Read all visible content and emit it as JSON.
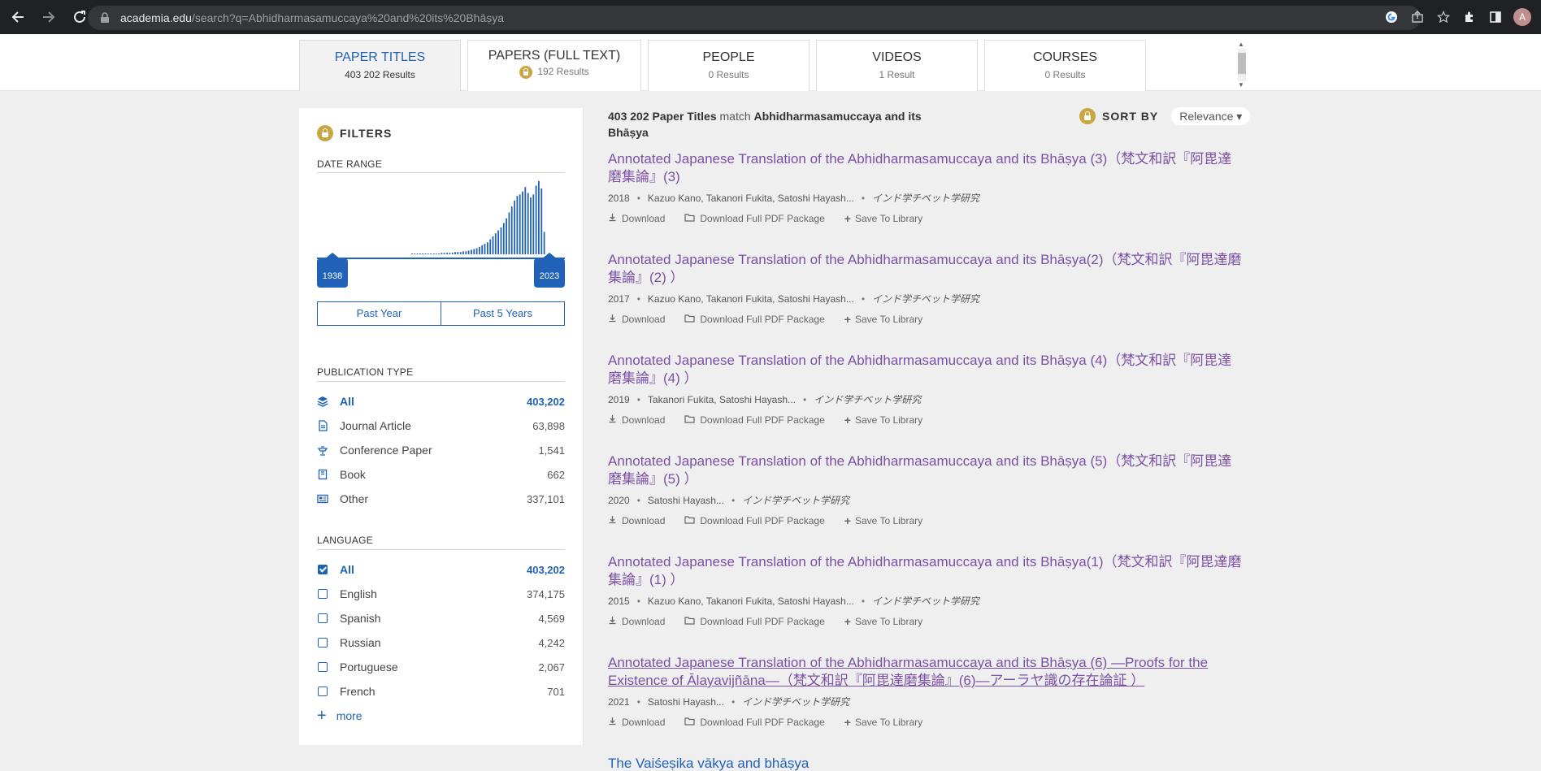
{
  "browser": {
    "url_domain": "academia.edu",
    "url_path": "/search?q=Abhidharmasamuccaya%20and%20its%20Bhāṣya",
    "avatar_letter": "A"
  },
  "tabs": [
    {
      "label": "PAPER TITLES",
      "count": "403 202 Results"
    },
    {
      "label": "PAPERS (FULL TEXT)",
      "count": "192 Results"
    },
    {
      "label": "PEOPLE",
      "count": "0 Results"
    },
    {
      "label": "VIDEOS",
      "count": "1 Result"
    },
    {
      "label": "COURSES",
      "count": "0 Results"
    }
  ],
  "filters": {
    "title": "FILTERS",
    "date_range_label": "DATE RANGE",
    "year_start": "1938",
    "year_end": "2023",
    "histogram_levels": [
      0.01,
      0.01,
      0.01,
      0.01,
      0.01,
      0.01,
      0.01,
      0.01,
      0.01,
      0.01,
      0.01,
      0.02,
      0.02,
      0.02,
      0.02,
      0.02,
      0.03,
      0.03,
      0.03,
      0.04,
      0.04,
      0.05,
      0.06,
      0.07,
      0.08,
      0.1,
      0.12,
      0.14,
      0.16,
      0.2,
      0.24,
      0.28,
      0.32,
      0.36,
      0.42,
      0.48,
      0.56,
      0.64,
      0.72,
      0.78,
      0.8,
      0.84,
      0.9,
      0.82,
      0.76,
      0.8,
      0.92,
      0.98,
      0.88,
      0.3
    ],
    "past_year": "Past Year",
    "past_5_years": "Past 5 Years",
    "publication_type_label": "PUBLICATION TYPE",
    "publication_types": [
      {
        "label": "All",
        "count": "403,202",
        "selected": true,
        "icon": "layers-icon"
      },
      {
        "label": "Journal Article",
        "count": "63,898",
        "selected": false,
        "icon": "document-icon"
      },
      {
        "label": "Conference Paper",
        "count": "1,541",
        "selected": false,
        "icon": "lectern-icon"
      },
      {
        "label": "Book",
        "count": "662",
        "selected": false,
        "icon": "book-icon"
      },
      {
        "label": "Other",
        "count": "337,101",
        "selected": false,
        "icon": "newspaper-icon"
      }
    ],
    "language_label": "LANGUAGE",
    "languages": [
      {
        "label": "All",
        "count": "403,202",
        "selected": true
      },
      {
        "label": "English",
        "count": "374,175",
        "selected": false
      },
      {
        "label": "Spanish",
        "count": "4,569",
        "selected": false
      },
      {
        "label": "Russian",
        "count": "4,242",
        "selected": false
      },
      {
        "label": "Portuguese",
        "count": "2,067",
        "selected": false
      },
      {
        "label": "French",
        "count": "701",
        "selected": false
      }
    ],
    "more": "more"
  },
  "results_summary": {
    "count": "403 202 Paper Titles",
    "match_word": " match ",
    "query": "Abhidharmasamuccaya and its Bhāṣya"
  },
  "sort": {
    "label": "SORT BY",
    "value": "Relevance ▾"
  },
  "actions": {
    "download": "Download",
    "pdf_package": "Download Full PDF Package",
    "save": "Save To Library"
  },
  "results": [
    {
      "title": "Annotated Japanese Translation of the Abhidharmasamuccaya and its Bhāṣya (3)（梵文和訳『阿毘達磨集論』(3)",
      "year": "2018",
      "authors": "Kazuo Kano, Takanori Fukita, Satoshi Hayash...",
      "journal": "インド学チベット学研究"
    },
    {
      "title": "Annotated Japanese Translation of the Abhidharmasamuccaya and its Bhāṣya(2)（梵文和訳『阿毘達磨集論』(2) ）",
      "year": "2017",
      "authors": "Kazuo Kano, Takanori Fukita, Satoshi Hayash...",
      "journal": "インド学チベット学研究"
    },
    {
      "title": "Annotated Japanese Translation of the Abhidharmasamuccaya and its Bhāṣya (4)（梵文和訳『阿毘達磨集論』(4) ）",
      "year": "2019",
      "authors": "Takanori Fukita, Satoshi Hayash...",
      "journal": "インド学チベット学研究"
    },
    {
      "title": "Annotated Japanese Translation of the Abhidharmasamuccaya and its Bhāṣya (5)（梵文和訳『阿毘達磨集論』(5) ）",
      "year": "2020",
      "authors": "Satoshi Hayash...",
      "journal": "インド学チベット学研究"
    },
    {
      "title": "Annotated Japanese Translation of the Abhidharmasamuccaya and its Bhāṣya(1)（梵文和訳『阿毘達磨集論』(1) ）",
      "year": "2015",
      "authors": "Kazuo Kano, Takanori Fukita, Satoshi Hayash...",
      "journal": "インド学チベット学研究"
    },
    {
      "title": "Annotated Japanese Translation of the Abhidharmasamuccaya and its Bhāṣya (6) ―Proofs for the Existence of Ālayavijñāna―（梵文和訳『阿毘達磨集論』(6)―アーラヤ識の存在論証 ）",
      "year": "2021",
      "authors": "Satoshi Hayash...",
      "journal": "インド学チベット学研究"
    }
  ],
  "partial_result": {
    "title": "The Vaiśeṣika vākya and bhāṣya"
  },
  "colors": {
    "accent_blue": "#1f62b8",
    "visited_purple": "#7b50a6",
    "lock_gold": "#c9a544"
  }
}
